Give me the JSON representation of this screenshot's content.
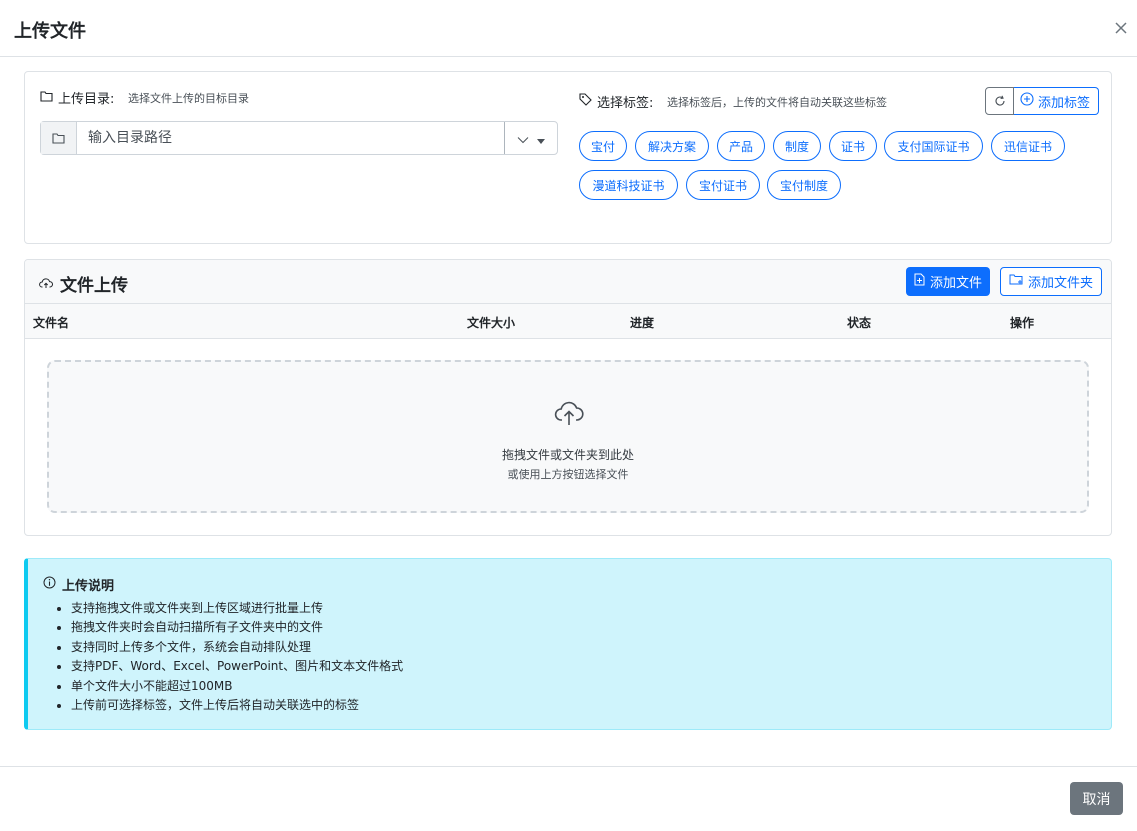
{
  "modal": {
    "title": "上传文件"
  },
  "directory": {
    "label": "上传目录:",
    "hint": "选择文件上传的目标目录",
    "placeholder": "输入目录路径"
  },
  "tags": {
    "label": "选择标签:",
    "hint": "选择标签后，上传的文件将自动关联这些标签",
    "add_label": "添加标签",
    "items": [
      "宝付",
      "解决方案",
      "产品",
      "制度",
      "证书",
      "支付国际证书",
      "迅信证书",
      "漫道科技证书",
      "宝付证书",
      "宝付制度"
    ]
  },
  "upload": {
    "title": "文件上传",
    "add_file": "添加文件",
    "add_folder": "添加文件夹",
    "columns": [
      "文件名",
      "文件大小",
      "进度",
      "状态",
      "操作"
    ],
    "dropzone_main": "拖拽文件或文件夹到此处",
    "dropzone_sub": "或使用上方按钮选择文件"
  },
  "notes": {
    "title": "上传说明",
    "items": [
      "支持拖拽文件或文件夹到上传区域进行批量上传",
      "拖拽文件夹时会自动扫描所有子文件夹中的文件",
      "支持同时上传多个文件，系统会自动排队处理",
      "支持PDF、Word、Excel、PowerPoint、图片和文本文件格式",
      "单个文件大小不能超过100MB",
      "上传前可选择标签，文件上传后将自动关联选中的标签"
    ]
  },
  "footer": {
    "cancel_label": "取消"
  },
  "colors": {
    "primary": "#0d6efd",
    "info_bg": "#cff4fc",
    "info_border": "#0dcaf0",
    "secondary": "#6c757d"
  }
}
